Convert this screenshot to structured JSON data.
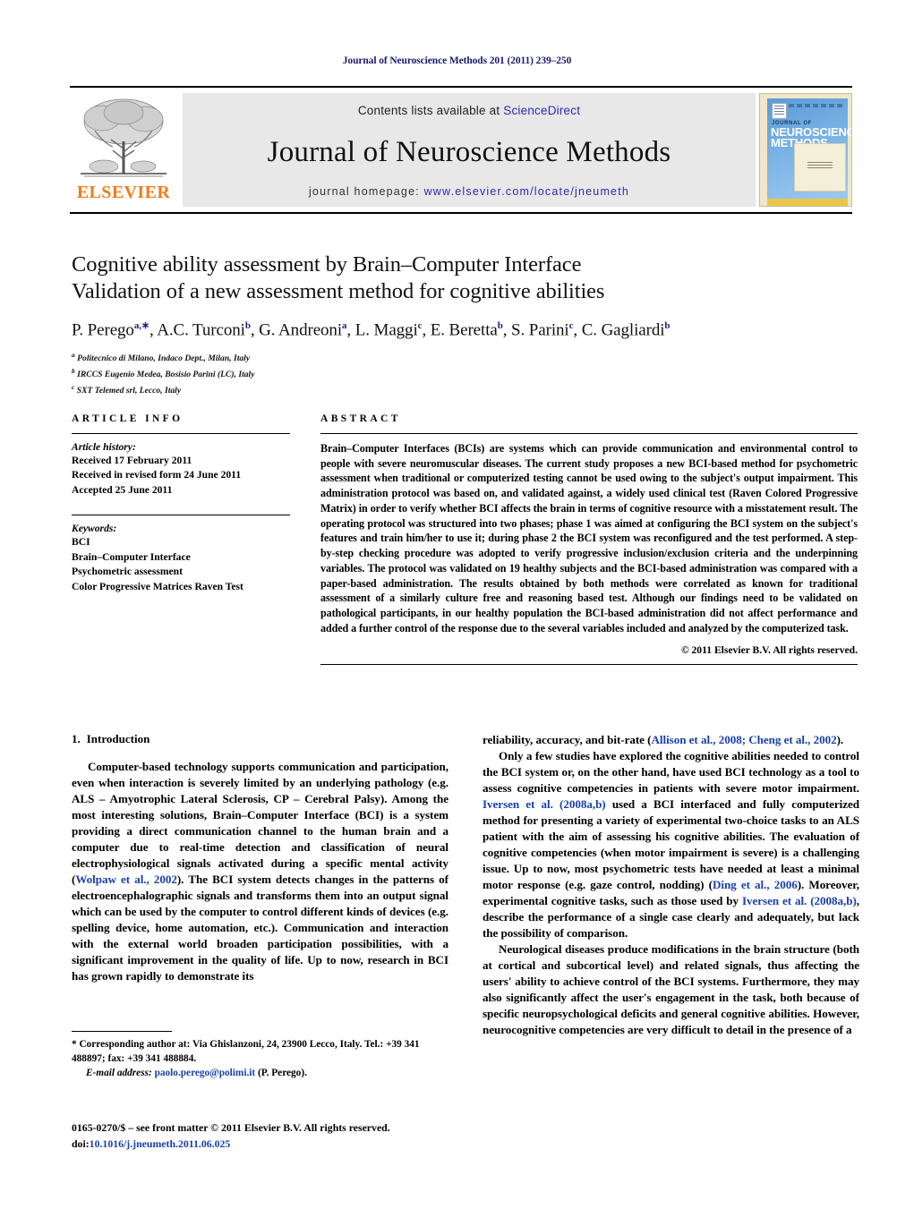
{
  "running_head": "Journal of Neuroscience Methods 201 (2011) 239–250",
  "masthead": {
    "publisher_name": "ELSEVIER",
    "contents_prefix": "Contents lists available at ",
    "contents_link": "ScienceDirect",
    "journal_title": "Journal of Neuroscience Methods",
    "homepage_prefix": "journal homepage: ",
    "homepage_url": "www.elsevier.com/locate/jneumeth",
    "cover": {
      "line1": "JOURNAL OF",
      "line2": "NEUROSCIENCE",
      "line3": "METHODS"
    },
    "link_color": "#2b2bb0",
    "brand_color": "#ef7d1a"
  },
  "title": {
    "line1": "Cognitive ability assessment by Brain–Computer Interface",
    "line2": "Validation of a new assessment method for cognitive abilities"
  },
  "authors_html": "P. Perego<sup>a,∗</sup>, A.C. Turconi<sup>b</sup>, G. Andreoni<sup>a</sup>, L. Maggi<sup>c</sup>, E. Beretta<sup>b</sup>, S. Parini<sup>c</sup>, C. Gagliardi<sup>b</sup>",
  "affiliations": [
    {
      "marker": "a",
      "text": "Politecnico di Milano, Indaco Dept., Milan, Italy"
    },
    {
      "marker": "b",
      "text": "IRCCS Eugenio Medea, Bosisio Parini (LC), Italy"
    },
    {
      "marker": "c",
      "text": "SXT Telemed srl, Lecco, Italy"
    }
  ],
  "article_info": {
    "heading": "ARTICLE INFO",
    "history_label": "Article history:",
    "history": [
      "Received 17 February 2011",
      "Received in revised form 24 June 2011",
      "Accepted 25 June 2011"
    ],
    "keywords_label": "Keywords:",
    "keywords": [
      "BCI",
      "Brain–Computer Interface",
      "Psychometric assessment",
      "Color Progressive Matrices Raven Test"
    ]
  },
  "abstract": {
    "heading": "ABSTRACT",
    "text": "Brain–Computer Interfaces (BCIs) are systems which can provide communication and environmental control to people with severe neuromuscular diseases. The current study proposes a new BCI-based method for psychometric assessment when traditional or computerized testing cannot be used owing to the subject's output impairment. This administration protocol was based on, and validated against, a widely used clinical test (Raven Colored Progressive Matrix) in order to verify whether BCI affects the brain in terms of cognitive resource with a misstatement result. The operating protocol was structured into two phases; phase 1 was aimed at configuring the BCI system on the subject's features and train him/her to use it; during phase 2 the BCI system was reconfigured and the test performed. A step-by-step checking procedure was adopted to verify progressive inclusion/exclusion criteria and the underpinning variables. The protocol was validated on 19 healthy subjects and the BCI-based administration was compared with a paper-based administration. The results obtained by both methods were correlated as known for traditional assessment of a similarly culture free and reasoning based test. Although our findings need to be validated on pathological participants, in our healthy population the BCI-based administration did not affect performance and added a further control of the response due to the several variables included and analyzed by the computerized task.",
    "copyright": "© 2011 Elsevier B.V. All rights reserved."
  },
  "body": {
    "section_number": "1.",
    "section_title": "Introduction",
    "left_para_1": "Computer-based technology supports communication and participation, even when interaction is severely limited by an underlying pathology (e.g. ALS – Amyotrophic Lateral Sclerosis, CP – Cerebral Palsy). Among the most interesting solutions, Brain–Computer Interface (BCI) is a system providing a direct communication channel to the human brain and a computer due to real-time detection and classification of neural electrophysiological signals activated during a specific mental activity (",
    "left_cite_1": "Wolpaw et al., 2002",
    "left_para_1b": "). The BCI system detects changes in the patterns of electroencephalographic signals and transforms them into an output signal which can be used by the computer to control different kinds of devices (e.g. spelling device, home automation, etc.). Communication and interaction with the external world broaden participation possibilities, with a significant improvement in the quality of life. Up to now, research in BCI has grown rapidly to demonstrate its",
    "right_para_0a": "reliability, accuracy, and bit-rate (",
    "right_cite_0": "Allison et al., 2008; Cheng et al., 2002",
    "right_para_0b": ").",
    "right_para_1a": "Only a few studies have explored the cognitive abilities needed to control the BCI system or, on the other hand, have used BCI technology as a tool to assess cognitive competencies in patients with severe motor impairment. ",
    "right_cite_1": "Iversen et al. (2008a,b)",
    "right_para_1b": " used a BCI interfaced and fully computerized method for presenting a variety of experimental two-choice tasks to an ALS patient with the aim of assessing his cognitive abilities. The evaluation of cognitive competencies (when motor impairment is severe) is a challenging issue. Up to now, most psychometric tests have needed at least a minimal motor response (e.g. gaze control, nodding) (",
    "right_cite_2": "Ding et al., 2006",
    "right_para_1c": "). Moreover, experimental cognitive tasks, such as those used by ",
    "right_cite_3": "Iversen et al. (2008a,b)",
    "right_para_1d": ", describe the performance of a single case clearly and adequately, but lack the possibility of comparison.",
    "right_para_2": "Neurological diseases produce modifications in the brain structure (both at cortical and subcortical level) and related signals, thus affecting the users' ability to achieve control of the BCI systems. Furthermore, they may also significantly affect the user's engagement in the task, both because of specific neuropsychological deficits and general cognitive abilities. However, neurocognitive competencies are very difficult to detail in the presence of a"
  },
  "footnote": {
    "corresponding": "* Corresponding author at: Via Ghislanzoni, 24, 23900 Lecco, Italy. Tel.: +39 341 488897; fax: +39 341 488884.",
    "email_label": "E-mail address:",
    "email": "paolo.perego@polimi.it",
    "email_suffix": " (P. Perego)."
  },
  "issn": {
    "line1": "0165-0270/$ – see front matter © 2011 Elsevier B.V. All rights reserved.",
    "doi_prefix": "doi:",
    "doi": "10.1016/j.jneumeth.2011.06.025"
  }
}
